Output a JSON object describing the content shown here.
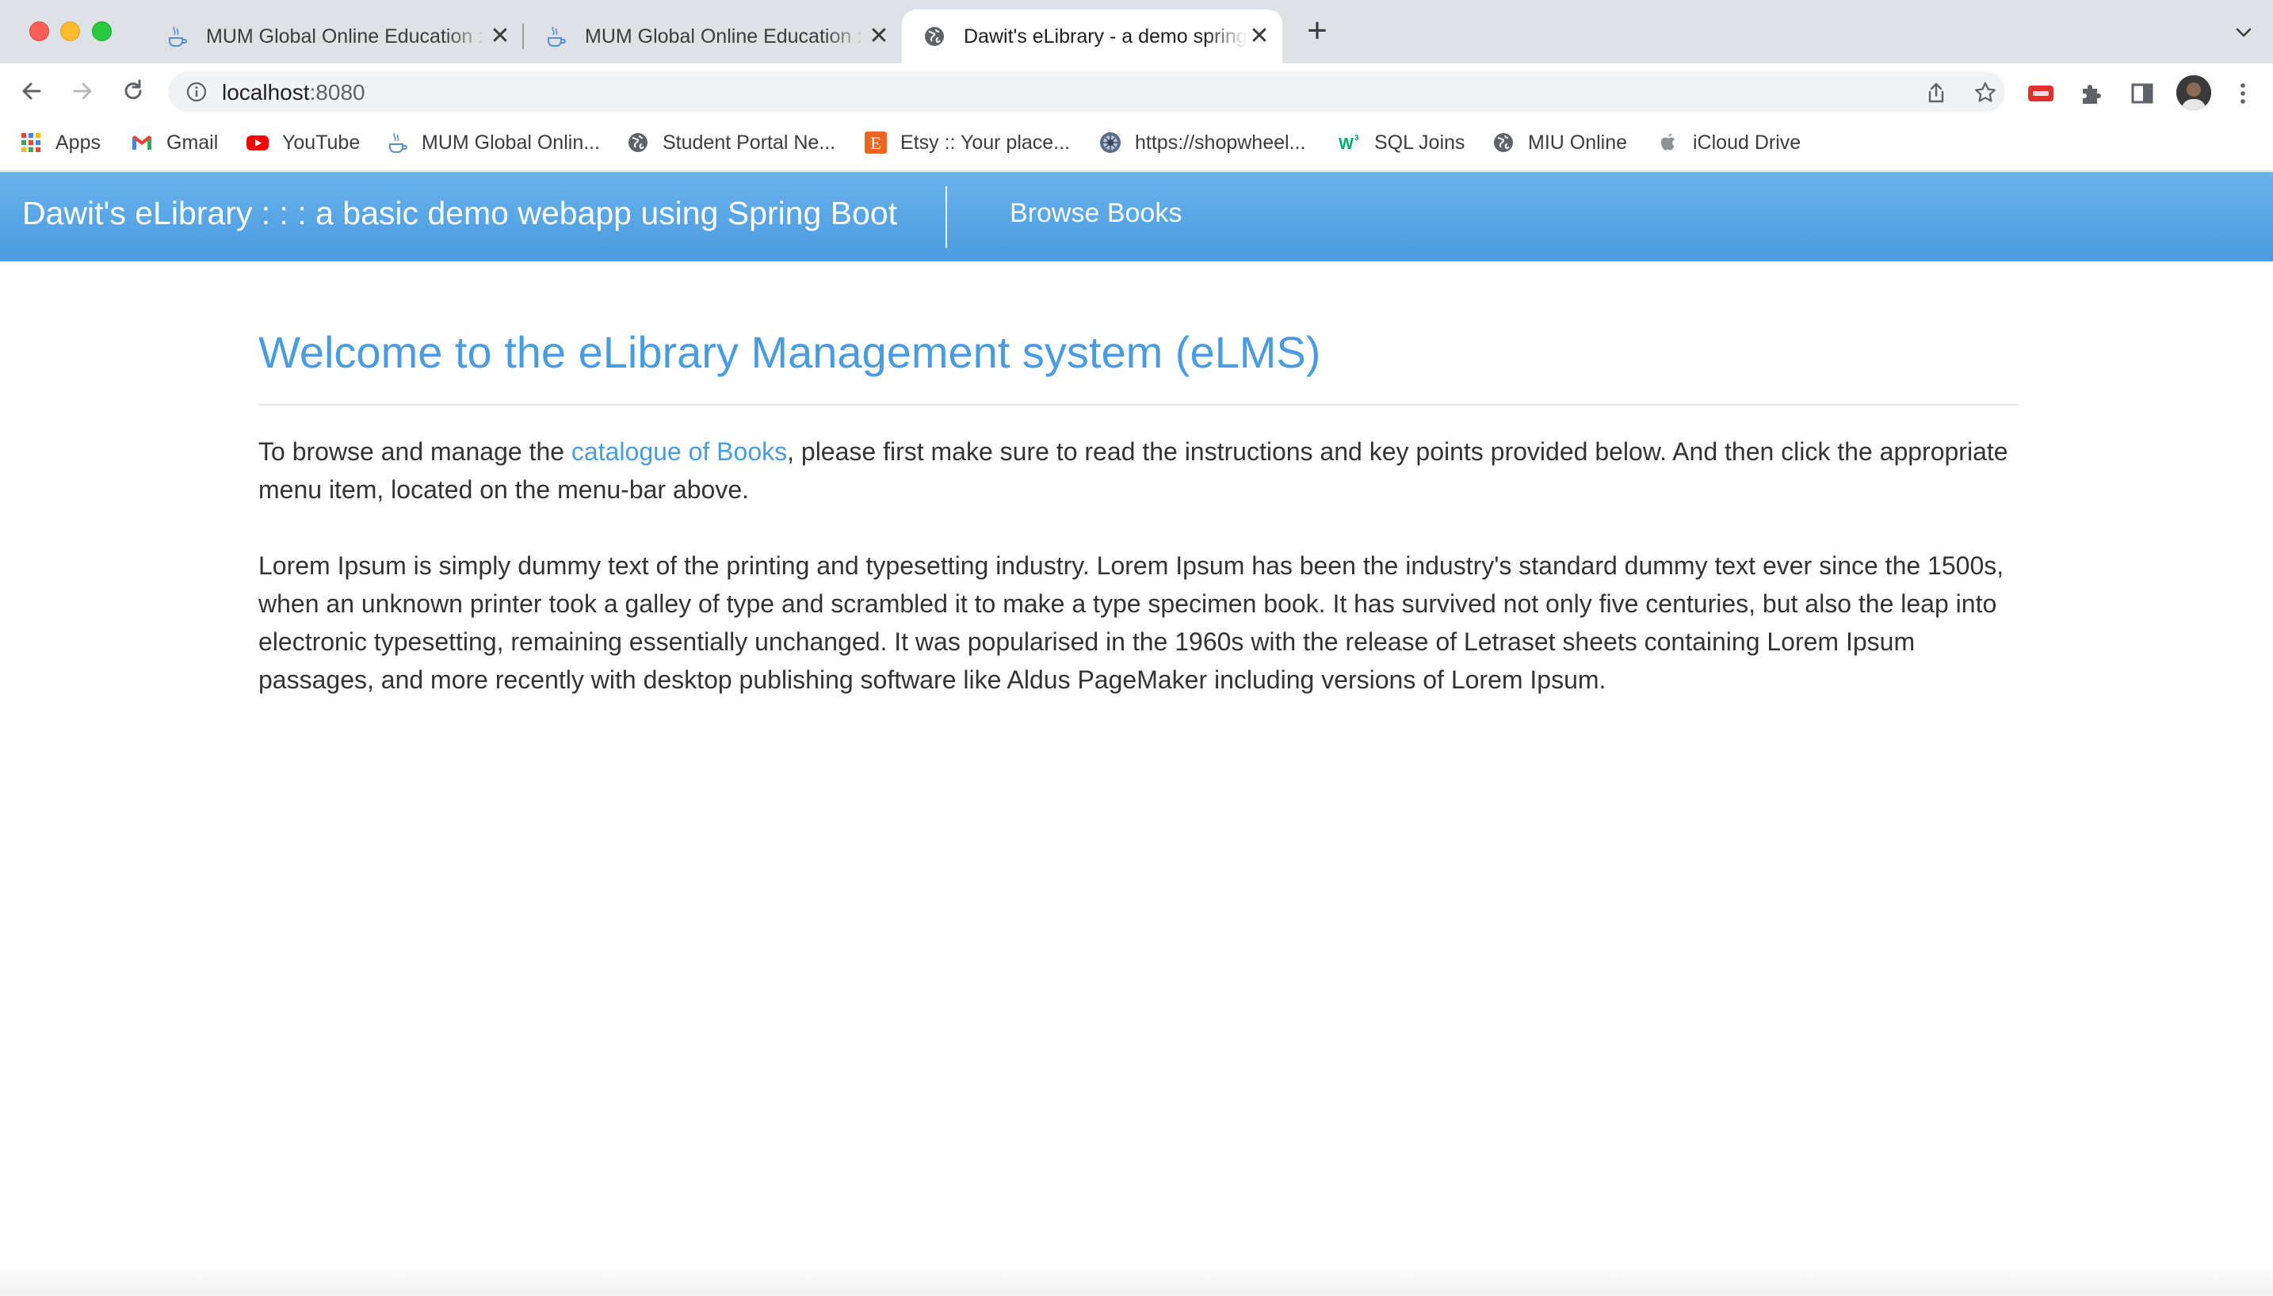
{
  "browser": {
    "tabs": [
      {
        "title": "MUM Global Online Education :",
        "icon": "java-cup-icon"
      },
      {
        "title": "MUM Global Online Education :",
        "icon": "java-cup-icon"
      },
      {
        "title": "Dawit's eLibrary - a demo spring",
        "icon": "globe-icon",
        "active": true
      }
    ],
    "new_tab": "+",
    "address": {
      "host": "localhost",
      "port": ":8080"
    },
    "bookmarks": [
      {
        "label": "Apps",
        "icon": "apps-grid-icon"
      },
      {
        "label": "Gmail",
        "icon": "gmail-icon"
      },
      {
        "label": "YouTube",
        "icon": "youtube-icon"
      },
      {
        "label": "MUM Global Onlin...",
        "icon": "java-cup-icon"
      },
      {
        "label": "Student Portal Ne...",
        "icon": "globe-icon"
      },
      {
        "label": "Etsy :: Your place...",
        "icon": "etsy-icon"
      },
      {
        "label": "https://shopwheel...",
        "icon": "wheel-icon"
      },
      {
        "label": "SQL Joins",
        "icon": "w3schools-icon"
      },
      {
        "label": "MIU Online",
        "icon": "globe-icon"
      },
      {
        "label": "iCloud Drive",
        "icon": "apple-icon"
      }
    ]
  },
  "app": {
    "brand": "Dawit's eLibrary : : : a basic demo webapp using Spring Boot",
    "nav_link": "Browse Books"
  },
  "main": {
    "title": "Welcome to the eLibrary Management system (eLMS)",
    "intro_before": "To browse and manage the ",
    "intro_link": "catalogue of Books",
    "intro_after": ", please first make sure to read the instructions and key points provided below. And then click the appropriate menu item, located on the menu-bar above.",
    "lorem": "Lorem Ipsum is simply dummy text of the printing and typesetting industry. Lorem Ipsum has been the industry's standard dummy text ever since the 1500s, when an unknown printer took a galley of type and scrambled it to make a type specimen book. It has survived not only five centuries, but also the leap into electronic typesetting, remaining essentially unchanged. It was popularised in the 1960s with the release of Letraset sheets containing Lorem Ipsum passages, and more recently with desktop publishing software like Aldus PageMaker including versions of Lorem Ipsum."
  },
  "colors": {
    "accent": "#4a9be0",
    "navbar": "#5aa7e6",
    "tabstrip": "#dee1e6"
  }
}
